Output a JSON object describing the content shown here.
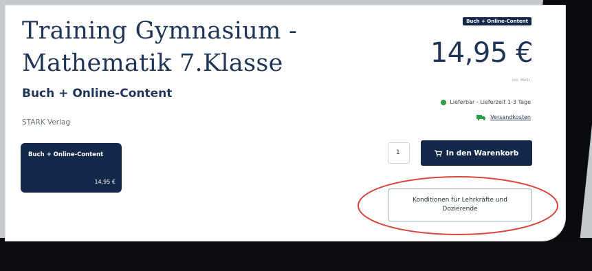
{
  "product": {
    "title": "Training Gymnasium - Mathematik 7.Klasse",
    "subtitle": "Buch + Online-Content",
    "publisher": "STARK Verlag"
  },
  "variant": {
    "label": "Buch + Online-Content",
    "price": "14,95 €"
  },
  "buybox": {
    "badge": "Buch + Online-Content",
    "price": "14,95 €",
    "tax_note": "inkl. MwSt.",
    "availability": "Lieferbar - Lieferzeit 1-3 Tage",
    "availability_color": "#2e9e45",
    "shipping_link": "Versandkosten",
    "shipping_icon": "truck-icon",
    "quantity": "1",
    "cart_button": "In den Warenkorb",
    "cart_icon": "cart-icon",
    "conditions_button": "Konditionen für Lehrkräfte und Dozierende"
  },
  "colors": {
    "brand_navy": "#14294a",
    "heading": "#1e3556",
    "highlight": "#d9463f"
  }
}
